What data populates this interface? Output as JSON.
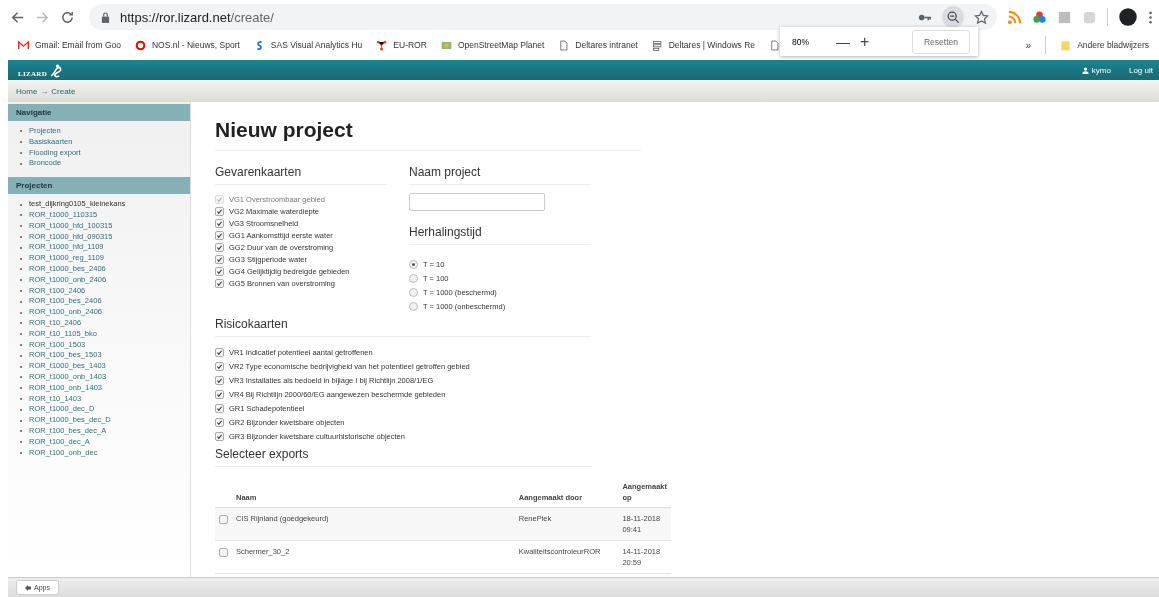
{
  "browser": {
    "url_host": "https://ror.lizard.net",
    "url_path": "/create/",
    "bookmarks": [
      {
        "label": "Gmail: Email from Goo",
        "kind": "gmail"
      },
      {
        "label": "NOS.nl - Nieuws, Sport",
        "kind": "ring"
      },
      {
        "label": "SAS Visual Analytics Hu",
        "kind": "sas"
      },
      {
        "label": "EU-ROR",
        "kind": "nodes"
      },
      {
        "label": "OpenStreetMap Planet",
        "kind": "map"
      },
      {
        "label": "Deltares intranet",
        "kind": "doc"
      },
      {
        "label": "Deltares | Windows Re",
        "kind": "server"
      },
      {
        "kind": "doc"
      }
    ],
    "overflow": "»",
    "other_bookmarks": "Andere bladwijzers",
    "zoom_popup": {
      "level": "80%",
      "minus": "—",
      "plus": "+",
      "reset": "Resetten"
    }
  },
  "header": {
    "logo": "LIZARD",
    "user": "kymo",
    "logout": "Log uit"
  },
  "breadcrumb": [
    "Home",
    "→",
    "Create"
  ],
  "sidebar": {
    "sections": [
      {
        "title": "Navigatie",
        "items": [
          "Projecten",
          "Basiskaarten",
          "Flooding export",
          "Broncode"
        ]
      },
      {
        "title": "Projecten",
        "items": [
          "test_dijkring0105_kleinekans",
          "ROR_t1000_110315",
          "ROR_t1000_hfd_100315",
          "ROR_t1000_hfd_090315",
          "ROR_t1000_hfd_1109",
          "ROR_t1000_reg_1109",
          "ROR_t1000_bes_2406",
          "ROR_t1000_onb_2406",
          "ROR_t100_2406",
          "ROR_t100_bes_2406",
          "ROR_t100_onb_2406",
          "ROR_t10_2406",
          "ROR_t10_1105_bko",
          "ROR_t100_1503",
          "ROR_t100_bes_1503",
          "ROR_t1000_bes_1403",
          "ROR_t1000_onb_1403",
          "ROR_t100_onb_1403",
          "ROR_t10_1403",
          "ROR_t1000_dec_D",
          "ROR_t1000_bes_dec_D",
          "ROR_t100_bes_dec_A",
          "ROR_t100_dec_A",
          "ROR_t100_onb_dec"
        ]
      }
    ]
  },
  "page_title": "Nieuw project",
  "gevarenkaarten": {
    "title": "Gevarenkaarten",
    "items": [
      {
        "label": "VG1 Overstroombaar gebied",
        "checked": true,
        "disabled": true
      },
      {
        "label": "VG2 Maximale waterdiepte",
        "checked": true,
        "disabled": false
      },
      {
        "label": "VG3 Stroomsnelheid",
        "checked": true,
        "disabled": false
      },
      {
        "label": "GG1 Aankomsttijd eerste water",
        "checked": true,
        "disabled": false
      },
      {
        "label": "GG2 Duur van de overstroming",
        "checked": true,
        "disabled": false
      },
      {
        "label": "GG3 Stijgperiode water",
        "checked": true,
        "disabled": false
      },
      {
        "label": "GG4 Gelijktijdig bedreigde gebieden",
        "checked": true,
        "disabled": false
      },
      {
        "label": "GG5 Bronnen van overstroming",
        "checked": true,
        "disabled": false
      }
    ]
  },
  "naam_project": {
    "title": "Naam project"
  },
  "herhalingstijd": {
    "title": "Herhalingstijd",
    "options": [
      {
        "label": "T = 10",
        "selected": true
      },
      {
        "label": "T = 100",
        "selected": false
      },
      {
        "label": "T = 1000 (beschermd)",
        "selected": false
      },
      {
        "label": "T = 1000 (onbeschermd)",
        "selected": false
      }
    ]
  },
  "risicokaarten": {
    "title": "Risicokaarten",
    "items": [
      {
        "label": "VR1 Indicatief potentieel aantal getroffenen",
        "checked": true,
        "disabled": false
      },
      {
        "label": "VR2 Type economische bedrijvigheid van het potentieel getroffen gebied",
        "checked": true,
        "disabled": false
      },
      {
        "label": "VR3 Installaties als bedoeld in bijlage I bij Richtlijn 2008/1/EG",
        "checked": true,
        "disabled": false
      },
      {
        "label": "VR4 Bij Richtlijn 2000/60/EG aangewezen beschermde gebieden",
        "checked": true,
        "disabled": false
      },
      {
        "label": "GR1 Schadepotentieel",
        "checked": true,
        "disabled": false
      },
      {
        "label": "GR2 Bijzonder kwetsbare objecten",
        "checked": true,
        "disabled": false
      },
      {
        "label": "GR3 Bijzonder kwetsbare cultuurhistorische objecten",
        "checked": true,
        "disabled": false
      }
    ]
  },
  "exports": {
    "title": "Selecteer exports",
    "columns": [
      "Naam",
      "Aangemaakt door",
      "Aangemaakt op"
    ],
    "rows": [
      {
        "name": "CIS Rijnland (goedgekeurd)",
        "by": "RenePiek",
        "date": "18-11-2018",
        "time": "09:41",
        "checked": false
      },
      {
        "name": "Schermer_30_2",
        "by": "KwaliteitscontroleurROR",
        "date": "14-11-2018",
        "time": "20:59",
        "checked": false
      }
    ]
  },
  "footer": {
    "apps": "Apps"
  }
}
